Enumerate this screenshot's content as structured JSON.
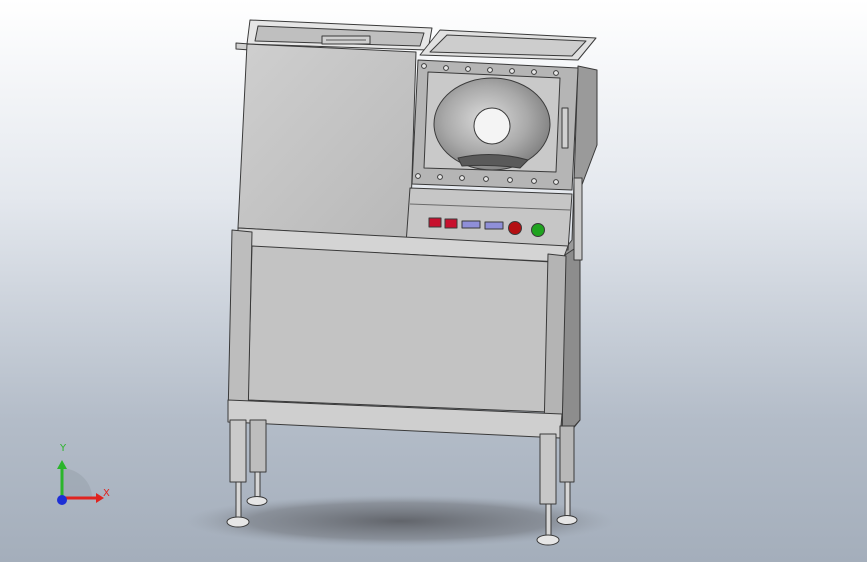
{
  "viewport": {
    "background_top": "#ffffff",
    "background_bottom": "#a4aebb"
  },
  "triad": {
    "x_label": "X",
    "y_label": "Y",
    "x_color": "#e0231f",
    "y_color": "#2bb52b",
    "z_color": "#1d2fd6"
  },
  "model": {
    "metal_light": "#d8d8d8",
    "metal_mid": "#bdbdbd",
    "metal_dark": "#8a8a8a",
    "button_red": "#b40f12",
    "button_green": "#1fa31f",
    "indicator_red": "#c8102e",
    "indicator_blue": "#8f8fd8"
  }
}
